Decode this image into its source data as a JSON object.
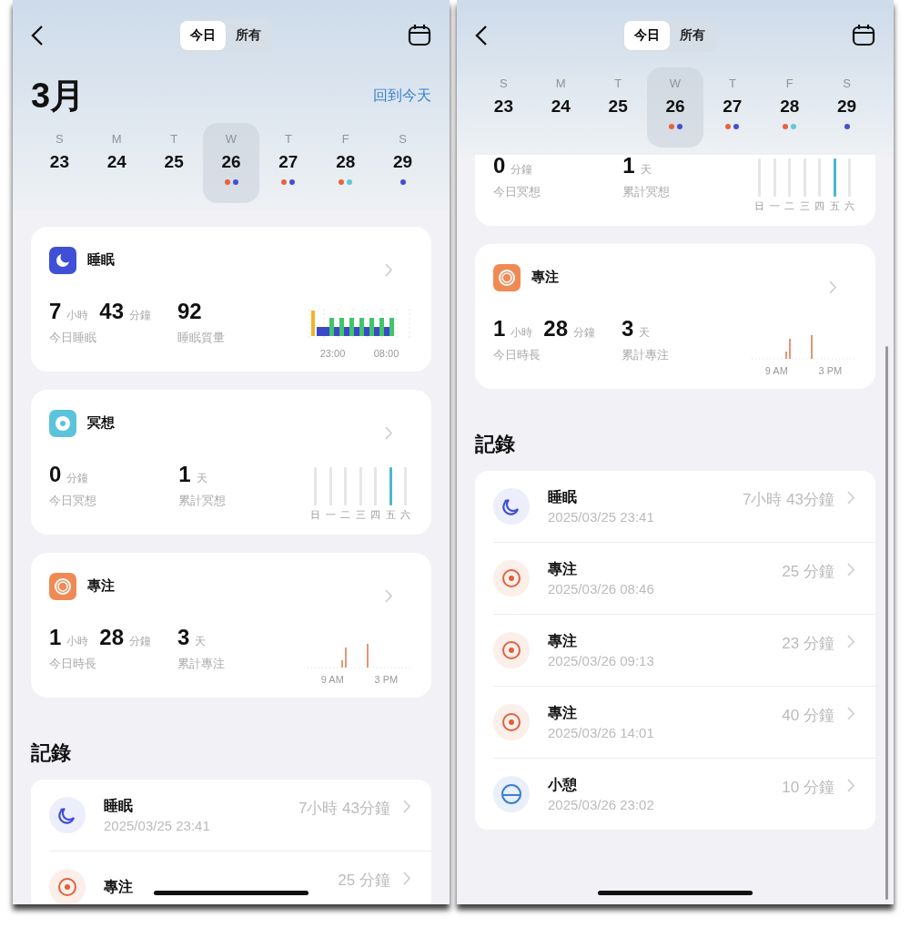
{
  "panes": [
    {
      "tabs": [
        {
          "label": "今日",
          "selected": true
        },
        {
          "label": "所有",
          "selected": false
        }
      ],
      "month": "3月",
      "today_link": "回到今天",
      "week": [
        {
          "dow": "S",
          "date": "23",
          "selected": false
        },
        {
          "dow": "M",
          "date": "24",
          "selected": false
        },
        {
          "dow": "T",
          "date": "25",
          "selected": false
        },
        {
          "dow": "W",
          "date": "26",
          "selected": true,
          "dots": [
            {
              "color": "#e8623f"
            },
            {
              "color": "#4450d0"
            }
          ]
        },
        {
          "dow": "T",
          "date": "27",
          "selected": false,
          "dots": [
            {
              "color": "#e8623f"
            },
            {
              "color": "#4450d0"
            }
          ]
        },
        {
          "dow": "F",
          "date": "28",
          "selected": false,
          "dots": [
            {
              "color": "#e8623f"
            },
            {
              "color": "#5ec8d8"
            }
          ]
        },
        {
          "dow": "S",
          "date": "29",
          "selected": false,
          "dots": [
            {
              "color": "#4450d0"
            }
          ]
        }
      ],
      "cards": [
        {
          "kind": "sleep",
          "title": "睡眠",
          "stats": [
            {
              "parts": [
                {
                  "value": "7",
                  "unit": "小時"
                },
                {
                  "value": "43",
                  "unit": "分鐘"
                }
              ],
              "label": "今日睡眠"
            },
            {
              "parts": [
                {
                  "value": "92"
                }
              ],
              "label": "睡眠質量"
            }
          ],
          "axis": [
            {
              "label": "23:00"
            },
            {
              "label": "08:00"
            }
          ]
        },
        {
          "kind": "meditation",
          "title": "冥想",
          "stats": [
            {
              "parts": [
                {
                  "value": "0",
                  "unit": "分鐘"
                }
              ],
              "label": "今日冥想"
            },
            {
              "parts": [
                {
                  "value": "1",
                  "unit": "天"
                }
              ],
              "label": "累計冥想"
            }
          ],
          "axis": [
            {
              "label": "日",
              "selected": false
            },
            {
              "label": "一",
              "selected": false
            },
            {
              "label": "二",
              "selected": false
            },
            {
              "label": "三",
              "selected": false
            },
            {
              "label": "四",
              "selected": false
            },
            {
              "label": "五",
              "selected": true
            },
            {
              "label": "六",
              "selected": false
            }
          ]
        },
        {
          "kind": "focus",
          "title": "專注",
          "stats": [
            {
              "parts": [
                {
                  "value": "1",
                  "unit": "小時"
                },
                {
                  "value": "28",
                  "unit": "分鐘"
                }
              ],
              "label": "今日時長"
            },
            {
              "parts": [
                {
                  "value": "3",
                  "unit": "天"
                }
              ],
              "label": "累計專注"
            }
          ],
          "axis": [
            {
              "label": "9 AM"
            },
            {
              "label": "3 PM"
            }
          ]
        }
      ],
      "records_title": "記錄",
      "records": [
        {
          "kind": "sleep",
          "title": "睡眠",
          "time": "2025/03/25 23:41",
          "duration": "7小時 43分鐘"
        },
        {
          "kind": "focus",
          "title": "專注",
          "duration": "25 分鐘"
        }
      ]
    },
    {
      "tabs": [
        {
          "label": "今日",
          "selected": true
        },
        {
          "label": "所有",
          "selected": false
        }
      ],
      "week": [
        {
          "dow": "S",
          "date": "23",
          "selected": false
        },
        {
          "dow": "M",
          "date": "24",
          "selected": false
        },
        {
          "dow": "T",
          "date": "25",
          "selected": false
        },
        {
          "dow": "W",
          "date": "26",
          "selected": true,
          "dots": [
            {
              "color": "#e8623f"
            },
            {
              "color": "#4450d0"
            }
          ]
        },
        {
          "dow": "T",
          "date": "27",
          "selected": false,
          "dots": [
            {
              "color": "#e8623f"
            },
            {
              "color": "#4450d0"
            }
          ]
        },
        {
          "dow": "F",
          "date": "28",
          "selected": false,
          "dots": [
            {
              "color": "#e8623f"
            },
            {
              "color": "#5ec8d8"
            }
          ]
        },
        {
          "dow": "S",
          "date": "29",
          "selected": false,
          "dots": [
            {
              "color": "#4450d0"
            }
          ]
        }
      ],
      "cards": [
        {
          "kind": "meditation",
          "stats": [
            {
              "parts": [
                {
                  "value": "0",
                  "unit": "分鐘"
                }
              ],
              "label": "今日冥想"
            },
            {
              "parts": [
                {
                  "value": "1",
                  "unit": "天"
                }
              ],
              "label": "累計冥想"
            }
          ],
          "axis": [
            {
              "label": "日",
              "selected": false
            },
            {
              "label": "一",
              "selected": false
            },
            {
              "label": "二",
              "selected": false
            },
            {
              "label": "三",
              "selected": false
            },
            {
              "label": "四",
              "selected": false
            },
            {
              "label": "五",
              "selected": true
            },
            {
              "label": "六",
              "selected": false
            }
          ]
        },
        {
          "kind": "focus",
          "title": "專注",
          "stats": [
            {
              "parts": [
                {
                  "value": "1",
                  "unit": "小時"
                },
                {
                  "value": "28",
                  "unit": "分鐘"
                }
              ],
              "label": "今日時長"
            },
            {
              "parts": [
                {
                  "value": "3",
                  "unit": "天"
                }
              ],
              "label": "累計專注"
            }
          ],
          "axis": [
            {
              "label": "9 AM"
            },
            {
              "label": "3 PM"
            }
          ]
        }
      ],
      "records_title": "記錄",
      "records": [
        {
          "kind": "sleep",
          "title": "睡眠",
          "time": "2025/03/25 23:41",
          "duration": "7小時 43分鐘"
        },
        {
          "kind": "focus",
          "title": "專注",
          "time": "2025/03/26 08:46",
          "duration": "25 分鐘"
        },
        {
          "kind": "focus",
          "title": "專注",
          "time": "2025/03/26 09:13",
          "duration": "23 分鐘"
        },
        {
          "kind": "focus",
          "title": "專注",
          "time": "2025/03/26 14:01",
          "duration": "40 分鐘"
        },
        {
          "kind": "break",
          "title": "小憩",
          "time": "2025/03/26 23:02",
          "duration": "10 分鐘"
        }
      ]
    }
  ]
}
